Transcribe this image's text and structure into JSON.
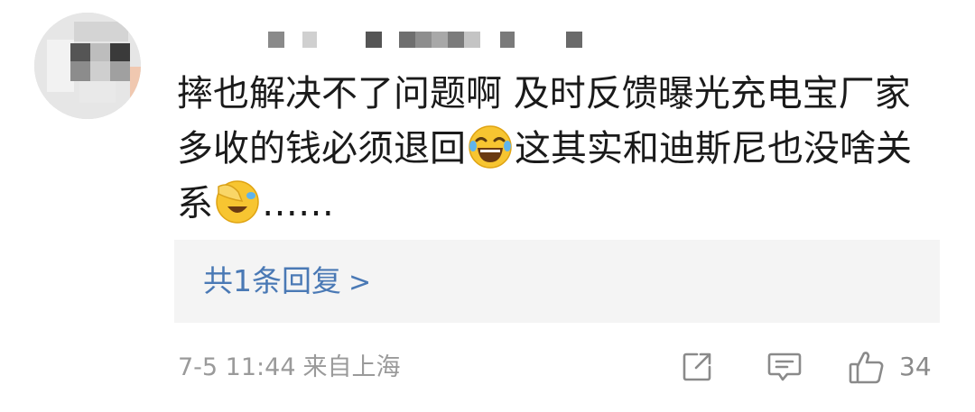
{
  "comment": {
    "text_part1": "摔也解决不了问题啊 及时反馈曝光充电宝厂家 多收的钱必须退回",
    "emoji1": "laugh-cry-emoji",
    "text_part2": "这其实和迪斯尼也没啥关系",
    "emoji2": "facepalm-laugh-emoji",
    "text_part3": "……"
  },
  "replies": {
    "label": "共1条回复",
    "chevron": ">"
  },
  "meta": {
    "date": "7-5 11:44",
    "location": "来自上海"
  },
  "actions": {
    "share_icon": "share-icon",
    "comment_icon": "comment-icon",
    "like_icon": "thumbs-up-icon",
    "like_count": "34"
  },
  "colors": {
    "link_blue": "#4a79b5",
    "meta_gray": "#9a9a9a",
    "reply_bg": "#f4f4f4"
  }
}
